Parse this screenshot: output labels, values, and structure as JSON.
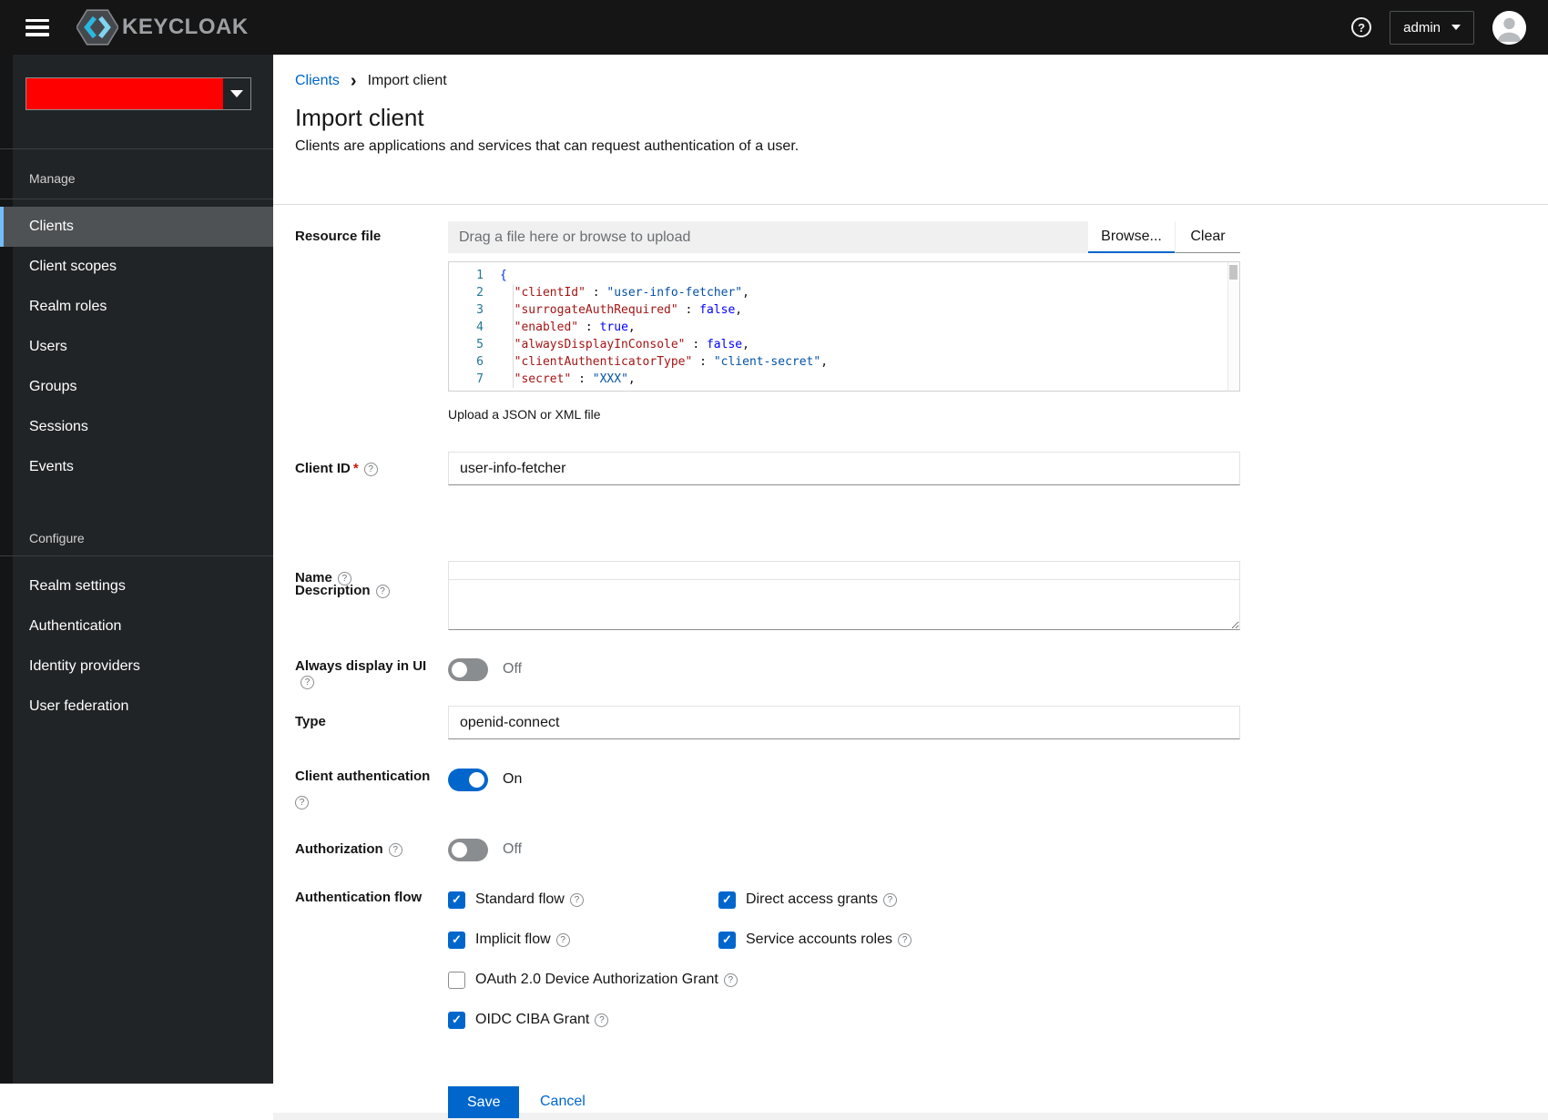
{
  "masthead": {
    "brand": "KEYCLOAK",
    "user": "admin"
  },
  "icons": {
    "help": "?",
    "check": "✓",
    "breadcrumb_sep": "›"
  },
  "sidebar": {
    "realm_selector": {
      "redacted_color": "#ff0000"
    },
    "sections": [
      {
        "title": "Manage",
        "items": [
          {
            "label": "Clients",
            "active": true
          },
          {
            "label": "Client scopes"
          },
          {
            "label": "Realm roles"
          },
          {
            "label": "Users"
          },
          {
            "label": "Groups"
          },
          {
            "label": "Sessions"
          },
          {
            "label": "Events"
          }
        ]
      },
      {
        "title": "Configure",
        "items": [
          {
            "label": "Realm settings"
          },
          {
            "label": "Authentication"
          },
          {
            "label": "Identity providers"
          },
          {
            "label": "User federation"
          }
        ]
      }
    ]
  },
  "breadcrumb": {
    "parent": "Clients",
    "current": "Import client"
  },
  "header": {
    "title": "Import client",
    "subtitle": "Clients are applications and services that can request authentication of a user."
  },
  "form": {
    "resource_file": {
      "label": "Resource file",
      "placeholder": "Drag a file here or browse to upload",
      "browse": "Browse...",
      "clear": "Clear",
      "helper": "Upload a JSON or XML file"
    },
    "editor": {
      "lines": [
        {
          "num": "1",
          "segments": [
            {
              "text": "{",
              "type": "brace"
            }
          ]
        },
        {
          "num": "2",
          "segments": [
            {
              "text": "  ",
              "type": "punct"
            },
            {
              "text": "\"clientId\"",
              "type": "key"
            },
            {
              "text": " : ",
              "type": "punct"
            },
            {
              "text": "\"user-info-fetcher\"",
              "type": "string"
            },
            {
              "text": ",",
              "type": "punct"
            }
          ]
        },
        {
          "num": "3",
          "segments": [
            {
              "text": "  ",
              "type": "punct"
            },
            {
              "text": "\"surrogateAuthRequired\"",
              "type": "key"
            },
            {
              "text": " : ",
              "type": "punct"
            },
            {
              "text": "false",
              "type": "bool"
            },
            {
              "text": ",",
              "type": "punct"
            }
          ]
        },
        {
          "num": "4",
          "segments": [
            {
              "text": "  ",
              "type": "punct"
            },
            {
              "text": "\"enabled\"",
              "type": "key"
            },
            {
              "text": " : ",
              "type": "punct"
            },
            {
              "text": "true",
              "type": "bool"
            },
            {
              "text": ",",
              "type": "punct"
            }
          ]
        },
        {
          "num": "5",
          "segments": [
            {
              "text": "  ",
              "type": "punct"
            },
            {
              "text": "\"alwaysDisplayInConsole\"",
              "type": "key"
            },
            {
              "text": " : ",
              "type": "punct"
            },
            {
              "text": "false",
              "type": "bool"
            },
            {
              "text": ",",
              "type": "punct"
            }
          ]
        },
        {
          "num": "6",
          "segments": [
            {
              "text": "  ",
              "type": "punct"
            },
            {
              "text": "\"clientAuthenticatorType\"",
              "type": "key"
            },
            {
              "text": " : ",
              "type": "punct"
            },
            {
              "text": "\"client-secret\"",
              "type": "string"
            },
            {
              "text": ",",
              "type": "punct"
            }
          ]
        },
        {
          "num": "7",
          "segments": [
            {
              "text": "  ",
              "type": "punct"
            },
            {
              "text": "\"secret\"",
              "type": "key"
            },
            {
              "text": " : ",
              "type": "punct"
            },
            {
              "text": "\"XXX\"",
              "type": "string"
            },
            {
              "text": ",",
              "type": "punct"
            }
          ]
        }
      ]
    },
    "fields": {
      "client_id": {
        "label": "Client ID",
        "required": "*",
        "value": "user-info-fetcher"
      },
      "name": {
        "label": "Name",
        "value": ""
      },
      "description": {
        "label": "Description",
        "value": ""
      },
      "always_display": {
        "label": "Always display in UI",
        "state": "Off"
      },
      "type": {
        "label": "Type",
        "value": "openid-connect"
      },
      "client_authentication": {
        "label": "Client authentication",
        "state": "On"
      },
      "authorization": {
        "label": "Authorization",
        "state": "Off"
      },
      "authentication_flow": {
        "label": "Authentication flow",
        "options": [
          {
            "label": "Standard flow",
            "checked": true
          },
          {
            "label": "Direct access grants",
            "checked": true
          },
          {
            "label": "Implicit flow",
            "checked": true
          },
          {
            "label": "Service accounts roles",
            "checked": true
          },
          {
            "label": "OAuth 2.0 Device Authorization Grant",
            "checked": false
          },
          {
            "label": "OIDC CIBA Grant",
            "checked": true
          }
        ]
      }
    },
    "actions": {
      "save": "Save",
      "cancel": "Cancel"
    }
  },
  "colors": {
    "primary": "#0066cc",
    "masthead_bg": "#151515",
    "sidebar_bg": "#212427",
    "active_item_bg": "#4f5255",
    "active_item_border": "#73bcf7",
    "redacted_realm": "#ff0000",
    "code_key": "#a31515",
    "code_string_value": "#0451a5",
    "code_boolean": "#0000ff",
    "code_line_number": "#237893"
  }
}
